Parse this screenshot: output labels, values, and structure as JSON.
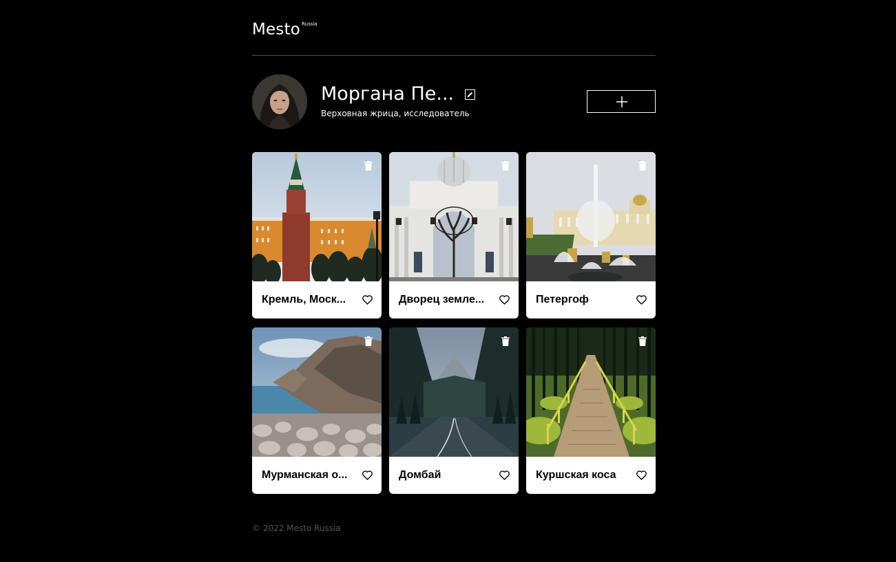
{
  "header": {
    "logo_main": "Mesto",
    "logo_sup": "Russia"
  },
  "profile": {
    "name": "Моргана Пе...",
    "about": "Верховная жрица, исследователь",
    "edit_icon": "pencil-icon",
    "add_icon": "plus-icon"
  },
  "cards": [
    {
      "title": "Кремль, Моск...",
      "image": "kremlin"
    },
    {
      "title": "Дворец земле...",
      "image": "palace"
    },
    {
      "title": "Петергоф",
      "image": "peterhof"
    },
    {
      "title": "Мурманская о...",
      "image": "murmansk"
    },
    {
      "title": "Домбай",
      "image": "dombay"
    },
    {
      "title": "Куршская коса",
      "image": "curonian-spit"
    }
  ],
  "footer": {
    "copyright": "© 2022 Mesto Russia"
  },
  "colors": {
    "background": "#000000",
    "card": "#ffffff",
    "footer_text": "#545454",
    "divider": "#545454"
  }
}
